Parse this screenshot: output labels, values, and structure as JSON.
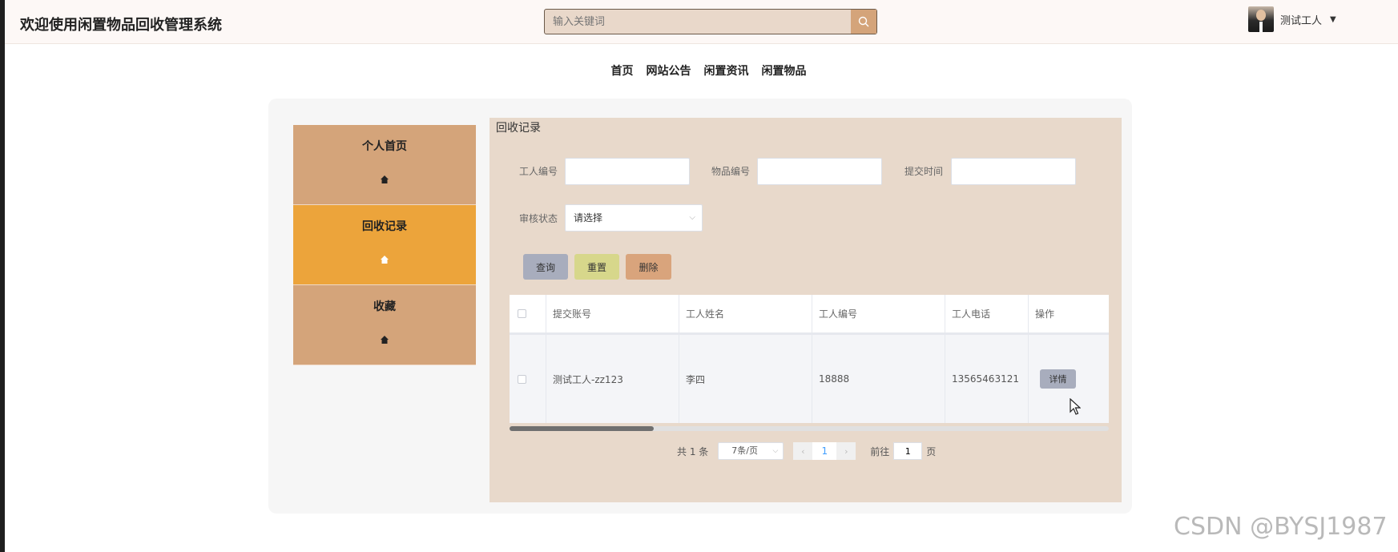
{
  "header": {
    "title": "欢迎使用闲置物品回收管理系统",
    "search_placeholder": "输入关键词",
    "user_name": "测试工人"
  },
  "nav": [
    "首页",
    "网站公告",
    "闲置资讯",
    "闲置物品"
  ],
  "sidebar": {
    "items": [
      {
        "label": "个人首页",
        "active": false
      },
      {
        "label": "回收记录",
        "active": true
      },
      {
        "label": "收藏",
        "active": false
      }
    ]
  },
  "content": {
    "title": "回收记录",
    "filters": {
      "worker_no_label": "工人编号",
      "item_no_label": "物品编号",
      "submit_time_label": "提交时间",
      "status_label": "审核状态",
      "status_value": "请选择"
    },
    "buttons": {
      "query": "查询",
      "reset": "重置",
      "delete": "删除"
    },
    "table": {
      "headers": [
        "提交账号",
        "工人姓名",
        "工人编号",
        "工人电话",
        "操作"
      ],
      "rows": [
        {
          "account": "测试工人-zz123",
          "worker_name": "李四",
          "worker_no": "18888",
          "phone": "13565463121",
          "action": "详情"
        }
      ]
    },
    "pager": {
      "total": "共 1 条",
      "page_size": "7条/页",
      "current_page": "1",
      "goto_label": "前往",
      "goto_value": "1",
      "page_suffix": "页"
    }
  },
  "watermark": "CSDN @BYSJ1987",
  "colors": {
    "accent_tan": "#d4a47a",
    "active_orange": "#eca43b",
    "content_bg": "#e8d9cb"
  }
}
